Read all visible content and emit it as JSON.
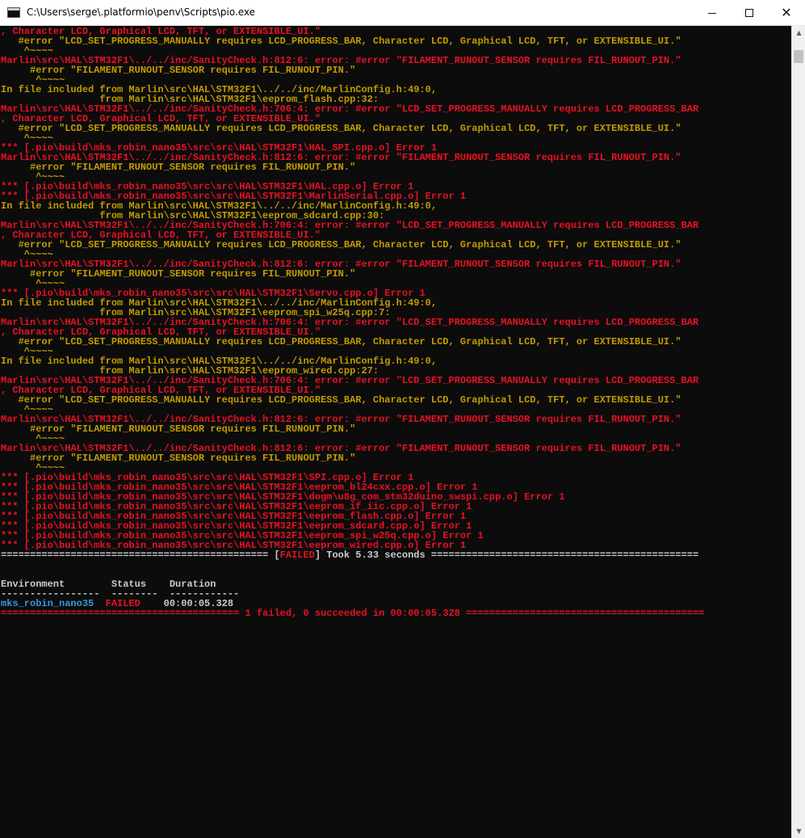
{
  "window": {
    "title": "C:\\Users\\serge\\.platformio\\penv\\Scripts\\pio.exe",
    "minimize_glyph": "",
    "maximize_glyph": "",
    "close_glyph": "✕"
  },
  "colors": {
    "background": "#0c0c0c",
    "red": "#e81123",
    "yellow": "#c19c00",
    "white": "#cccccc",
    "cyan": "#3a96dd"
  },
  "console": {
    "lines": [
      [
        {
          "c": "red",
          "t": ", Character LCD, Graphical LCD, TFT, or EXTENSIBLE_UI.\""
        }
      ],
      [
        {
          "c": "yellow",
          "t": "   #error \"LCD_SET_PROGRESS_MANUALLY requires LCD_PROGRESS_BAR, Character LCD, Graphical LCD, TFT, or EXTENSIBLE_UI.\""
        }
      ],
      [
        {
          "c": "yellow",
          "t": "    ^~~~~"
        }
      ],
      [
        {
          "c": "red",
          "t": "Marlin\\src\\HAL\\STM32F1\\../../inc/SanityCheck.h:812:6: error: #error \"FILAMENT_RUNOUT_SENSOR requires FIL_RUNOUT_PIN.\""
        }
      ],
      [
        {
          "c": "yellow",
          "t": "     #error \"FILAMENT_RUNOUT_SENSOR requires FIL_RUNOUT_PIN.\""
        }
      ],
      [
        {
          "c": "yellow",
          "t": "      ^~~~~"
        }
      ],
      [
        {
          "c": "yellow",
          "t": "In file included from Marlin\\src\\HAL\\STM32F1\\../../inc/MarlinConfig.h:49:0,"
        }
      ],
      [
        {
          "c": "yellow",
          "t": "                 from Marlin\\src\\HAL\\STM32F1\\eeprom_flash.cpp:32:"
        }
      ],
      [
        {
          "c": "red",
          "t": "Marlin\\src\\HAL\\STM32F1\\../../inc/SanityCheck.h:706:4: error: #error \"LCD_SET_PROGRESS_MANUALLY requires LCD_PROGRESS_BAR"
        }
      ],
      [
        {
          "c": "red",
          "t": ", Character LCD, Graphical LCD, TFT, or EXTENSIBLE_UI.\""
        }
      ],
      [
        {
          "c": "yellow",
          "t": "   #error \"LCD_SET_PROGRESS_MANUALLY requires LCD_PROGRESS_BAR, Character LCD, Graphical LCD, TFT, or EXTENSIBLE_UI.\""
        }
      ],
      [
        {
          "c": "yellow",
          "t": "    ^~~~~"
        }
      ],
      [
        {
          "c": "red",
          "t": "*** [.pio\\build\\mks_robin_nano35\\src\\src\\HAL\\STM32F1\\HAL_SPI.cpp.o] Error 1"
        }
      ],
      [
        {
          "c": "red",
          "t": "Marlin\\src\\HAL\\STM32F1\\../../inc/SanityCheck.h:812:6: error: #error \"FILAMENT_RUNOUT_SENSOR requires FIL_RUNOUT_PIN.\""
        }
      ],
      [
        {
          "c": "yellow",
          "t": "     #error \"FILAMENT_RUNOUT_SENSOR requires FIL_RUNOUT_PIN.\""
        }
      ],
      [
        {
          "c": "yellow",
          "t": "      ^~~~~"
        }
      ],
      [
        {
          "c": "red",
          "t": "*** [.pio\\build\\mks_robin_nano35\\src\\src\\HAL\\STM32F1\\HAL.cpp.o] Error 1"
        }
      ],
      [
        {
          "c": "red",
          "t": "*** [.pio\\build\\mks_robin_nano35\\src\\src\\HAL\\STM32F1\\MarlinSerial.cpp.o] Error 1"
        }
      ],
      [
        {
          "c": "yellow",
          "t": "In file included from Marlin\\src\\HAL\\STM32F1\\../../inc/MarlinConfig.h:49:0,"
        }
      ],
      [
        {
          "c": "yellow",
          "t": "                 from Marlin\\src\\HAL\\STM32F1\\eeprom_sdcard.cpp:30:"
        }
      ],
      [
        {
          "c": "red",
          "t": "Marlin\\src\\HAL\\STM32F1\\../../inc/SanityCheck.h:706:4: error: #error \"LCD_SET_PROGRESS_MANUALLY requires LCD_PROGRESS_BAR"
        }
      ],
      [
        {
          "c": "red",
          "t": ", Character LCD, Graphical LCD, TFT, or EXTENSIBLE_UI.\""
        }
      ],
      [
        {
          "c": "yellow",
          "t": "   #error \"LCD_SET_PROGRESS_MANUALLY requires LCD_PROGRESS_BAR, Character LCD, Graphical LCD, TFT, or EXTENSIBLE_UI.\""
        }
      ],
      [
        {
          "c": "yellow",
          "t": "    ^~~~~"
        }
      ],
      [
        {
          "c": "red",
          "t": "Marlin\\src\\HAL\\STM32F1\\../../inc/SanityCheck.h:812:6: error: #error \"FILAMENT_RUNOUT_SENSOR requires FIL_RUNOUT_PIN.\""
        }
      ],
      [
        {
          "c": "yellow",
          "t": "     #error \"FILAMENT_RUNOUT_SENSOR requires FIL_RUNOUT_PIN.\""
        }
      ],
      [
        {
          "c": "yellow",
          "t": "      ^~~~~"
        }
      ],
      [
        {
          "c": "red",
          "t": "*** [.pio\\build\\mks_robin_nano35\\src\\src\\HAL\\STM32F1\\Servo.cpp.o] Error 1"
        }
      ],
      [
        {
          "c": "yellow",
          "t": "In file included from Marlin\\src\\HAL\\STM32F1\\../../inc/MarlinConfig.h:49:0,"
        }
      ],
      [
        {
          "c": "yellow",
          "t": "                 from Marlin\\src\\HAL\\STM32F1\\eeprom_spi_w25q.cpp:7:"
        }
      ],
      [
        {
          "c": "red",
          "t": "Marlin\\src\\HAL\\STM32F1\\../../inc/SanityCheck.h:706:4: error: #error \"LCD_SET_PROGRESS_MANUALLY requires LCD_PROGRESS_BAR"
        }
      ],
      [
        {
          "c": "red",
          "t": ", Character LCD, Graphical LCD, TFT, or EXTENSIBLE_UI.\""
        }
      ],
      [
        {
          "c": "yellow",
          "t": "   #error \"LCD_SET_PROGRESS_MANUALLY requires LCD_PROGRESS_BAR, Character LCD, Graphical LCD, TFT, or EXTENSIBLE_UI.\""
        }
      ],
      [
        {
          "c": "yellow",
          "t": "    ^~~~~"
        }
      ],
      [
        {
          "c": "yellow",
          "t": "In file included from Marlin\\src\\HAL\\STM32F1\\../../inc/MarlinConfig.h:49:0,"
        }
      ],
      [
        {
          "c": "yellow",
          "t": "                 from Marlin\\src\\HAL\\STM32F1\\eeprom_wired.cpp:27:"
        }
      ],
      [
        {
          "c": "red",
          "t": "Marlin\\src\\HAL\\STM32F1\\../../inc/SanityCheck.h:706:4: error: #error \"LCD_SET_PROGRESS_MANUALLY requires LCD_PROGRESS_BAR"
        }
      ],
      [
        {
          "c": "red",
          "t": ", Character LCD, Graphical LCD, TFT, or EXTENSIBLE_UI.\""
        }
      ],
      [
        {
          "c": "yellow",
          "t": "   #error \"LCD_SET_PROGRESS_MANUALLY requires LCD_PROGRESS_BAR, Character LCD, Graphical LCD, TFT, or EXTENSIBLE_UI.\""
        }
      ],
      [
        {
          "c": "yellow",
          "t": "    ^~~~~"
        }
      ],
      [
        {
          "c": "red",
          "t": "Marlin\\src\\HAL\\STM32F1\\../../inc/SanityCheck.h:812:6: error: #error \"FILAMENT_RUNOUT_SENSOR requires FIL_RUNOUT_PIN.\""
        }
      ],
      [
        {
          "c": "yellow",
          "t": "     #error \"FILAMENT_RUNOUT_SENSOR requires FIL_RUNOUT_PIN.\""
        }
      ],
      [
        {
          "c": "yellow",
          "t": "      ^~~~~"
        }
      ],
      [
        {
          "c": "red",
          "t": "Marlin\\src\\HAL\\STM32F1\\../../inc/SanityCheck.h:812:6: error: #error \"FILAMENT_RUNOUT_SENSOR requires FIL_RUNOUT_PIN.\""
        }
      ],
      [
        {
          "c": "yellow",
          "t": "     #error \"FILAMENT_RUNOUT_SENSOR requires FIL_RUNOUT_PIN.\""
        }
      ],
      [
        {
          "c": "yellow",
          "t": "      ^~~~~"
        }
      ],
      [
        {
          "c": "red",
          "t": "*** [.pio\\build\\mks_robin_nano35\\src\\src\\HAL\\STM32F1\\SPI.cpp.o] Error 1"
        }
      ],
      [
        {
          "c": "red",
          "t": "*** [.pio\\build\\mks_robin_nano35\\src\\src\\HAL\\STM32F1\\eeprom_bl24cxx.cpp.o] Error 1"
        }
      ],
      [
        {
          "c": "red",
          "t": "*** [.pio\\build\\mks_robin_nano35\\src\\src\\HAL\\STM32F1\\dogm\\u8g_com_stm32duino_swspi.cpp.o] Error 1"
        }
      ],
      [
        {
          "c": "red",
          "t": "*** [.pio\\build\\mks_robin_nano35\\src\\src\\HAL\\STM32F1\\eeprom_if_iic.cpp.o] Error 1"
        }
      ],
      [
        {
          "c": "red",
          "t": "*** [.pio\\build\\mks_robin_nano35\\src\\src\\HAL\\STM32F1\\eeprom_flash.cpp.o] Error 1"
        }
      ],
      [
        {
          "c": "red",
          "t": "*** [.pio\\build\\mks_robin_nano35\\src\\src\\HAL\\STM32F1\\eeprom_sdcard.cpp.o] Error 1"
        }
      ],
      [
        {
          "c": "red",
          "t": "*** [.pio\\build\\mks_robin_nano35\\src\\src\\HAL\\STM32F1\\eeprom_spi_w25q.cpp.o] Error 1"
        }
      ],
      [
        {
          "c": "red",
          "t": "*** [.pio\\build\\mks_robin_nano35\\src\\src\\HAL\\STM32F1\\eeprom_wired.cpp.o] Error 1"
        }
      ],
      [
        {
          "c": "white",
          "t": "============================================== ["
        },
        {
          "c": "red",
          "t": "FAILED"
        },
        {
          "c": "white",
          "t": "] Took 5.33 seconds =============================================="
        }
      ],
      [
        {
          "c": "white",
          "t": ""
        }
      ],
      [
        {
          "c": "white",
          "t": ""
        }
      ],
      [
        {
          "c": "white",
          "t": "Environment        Status    Duration"
        }
      ],
      [
        {
          "c": "white",
          "t": "-----------------  --------  ------------"
        }
      ],
      [
        {
          "c": "cyan",
          "t": "mks_robin_nano35"
        },
        {
          "c": "white",
          "t": "  "
        },
        {
          "c": "red",
          "t": "FAILED"
        },
        {
          "c": "white",
          "t": "    00:00:05.328"
        }
      ],
      [
        {
          "c": "red",
          "t": "========================================= 1 failed, 0 succeeded in 00:00:05.328 ========================================="
        }
      ]
    ]
  }
}
